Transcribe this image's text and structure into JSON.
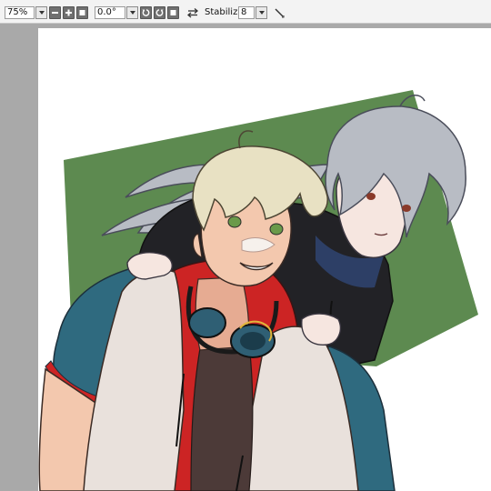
{
  "toolbar": {
    "zoom_value": "75%",
    "rotation_value": "0.0°",
    "stabilizer_label": "Stabilizer",
    "stabilizer_value": "8"
  },
  "colors": {
    "toolbar_bg": "#f3f3f3",
    "workspace_bg": "#a9a9a9",
    "canvas_bg": "#ffffff",
    "backdrop_green": "#5d8a50",
    "shirt_teal": "#2f6a7f",
    "jacket_red": "#cc2424",
    "vest_cream": "#e9e1dc",
    "hair_blond": "#e8e1c3",
    "hair_silver": "#b8bcc4",
    "hoodie_black": "#222226"
  },
  "icons": {
    "zoom_out": "minus-icon",
    "zoom_in": "plus-icon",
    "zoom_fit": "square-icon",
    "rotate_left": "rotate-left-icon",
    "rotate_right": "rotate-right-icon",
    "rotate_reset": "square-icon",
    "flip": "flip-arrows-icon",
    "pen": "pen-icon"
  }
}
